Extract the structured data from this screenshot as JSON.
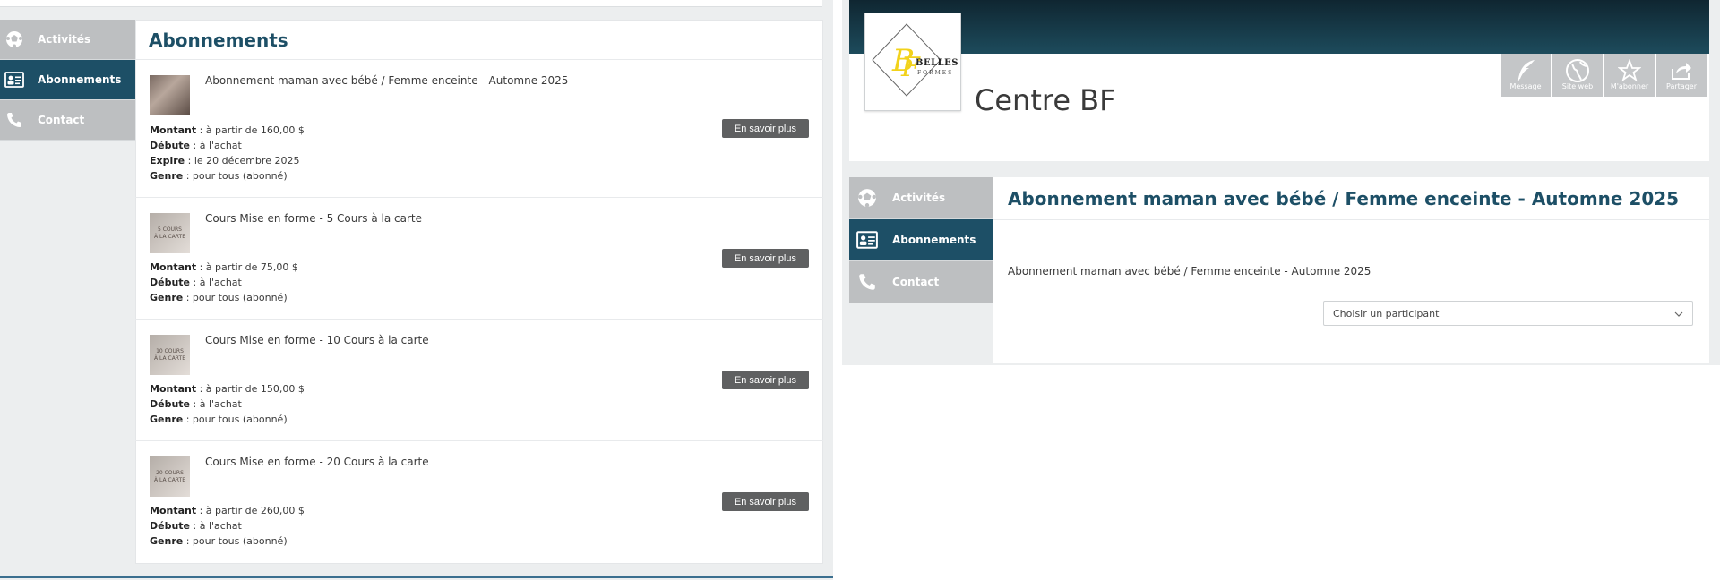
{
  "left": {
    "nav": [
      {
        "label": "Activités",
        "icon": "soccer-ball-icon"
      },
      {
        "label": "Abonnements",
        "icon": "id-card-icon"
      },
      {
        "label": "Contact",
        "icon": "phone-icon"
      }
    ],
    "title": "Abonnements",
    "subscriptions": [
      {
        "name": "Abonnement maman avec bébé / Femme enceinte - Automne 2025",
        "thumb_text": "",
        "details": [
          {
            "label": "Montant",
            "value": " : à partir de 160,00 $"
          },
          {
            "label": "Débute",
            "value": " : à l'achat"
          },
          {
            "label": "Expire",
            "value": " : le 20 décembre 2025"
          },
          {
            "label": "Genre",
            "value": " : pour tous (abonné)"
          }
        ],
        "button": "En savoir plus"
      },
      {
        "name": "Cours Mise en forme - 5 Cours à la carte",
        "thumb_text": "5 COURS\nÀ LA CARTE",
        "details": [
          {
            "label": "Montant",
            "value": " : à partir de 75,00 $"
          },
          {
            "label": "Débute",
            "value": " : à l'achat"
          },
          {
            "label": "Genre",
            "value": " : pour tous (abonné)"
          }
        ],
        "button": "En savoir plus"
      },
      {
        "name": "Cours Mise en forme - 10 Cours à la carte",
        "thumb_text": "10 COURS\nÀ LA CARTE",
        "details": [
          {
            "label": "Montant",
            "value": " : à partir de 150,00 $"
          },
          {
            "label": "Débute",
            "value": " : à l'achat"
          },
          {
            "label": "Genre",
            "value": " : pour tous (abonné)"
          }
        ],
        "button": "En savoir plus"
      },
      {
        "name": "Cours Mise en forme - 20 Cours à la carte",
        "thumb_text": "20 COURS\nÀ LA CARTE",
        "details": [
          {
            "label": "Montant",
            "value": " : à partir de 260,00 $"
          },
          {
            "label": "Débute",
            "value": " : à l'achat"
          },
          {
            "label": "Genre",
            "value": " : pour tous (abonné)"
          }
        ],
        "button": "En savoir plus"
      }
    ]
  },
  "right": {
    "logo": {
      "text_main": "BELLES",
      "text_sub": "FORMES",
      "monogram": "BF"
    },
    "centre_name": "Centre BF",
    "actions": [
      {
        "label": "Message",
        "icon": "feather-icon"
      },
      {
        "label": "Site web",
        "icon": "globe-icon"
      },
      {
        "label": "M'abonner",
        "icon": "star-icon"
      },
      {
        "label": "Partager",
        "icon": "share-icon"
      }
    ],
    "nav": [
      {
        "label": "Activités",
        "icon": "soccer-ball-icon"
      },
      {
        "label": "Abonnements",
        "icon": "id-card-icon"
      },
      {
        "label": "Contact",
        "icon": "phone-icon"
      }
    ],
    "title": "Abonnement maman avec bébé / Femme enceinte - Automne 2025",
    "description": "Abonnement maman avec bébé / Femme enceinte - Automne 2025",
    "participant_select": {
      "selected": "Choisir un participant"
    }
  },
  "colors": {
    "primary": "#1d4f66",
    "nav_gray": "#bdbfc1",
    "button_gray": "#5f6061",
    "banner": "#0f2631"
  }
}
